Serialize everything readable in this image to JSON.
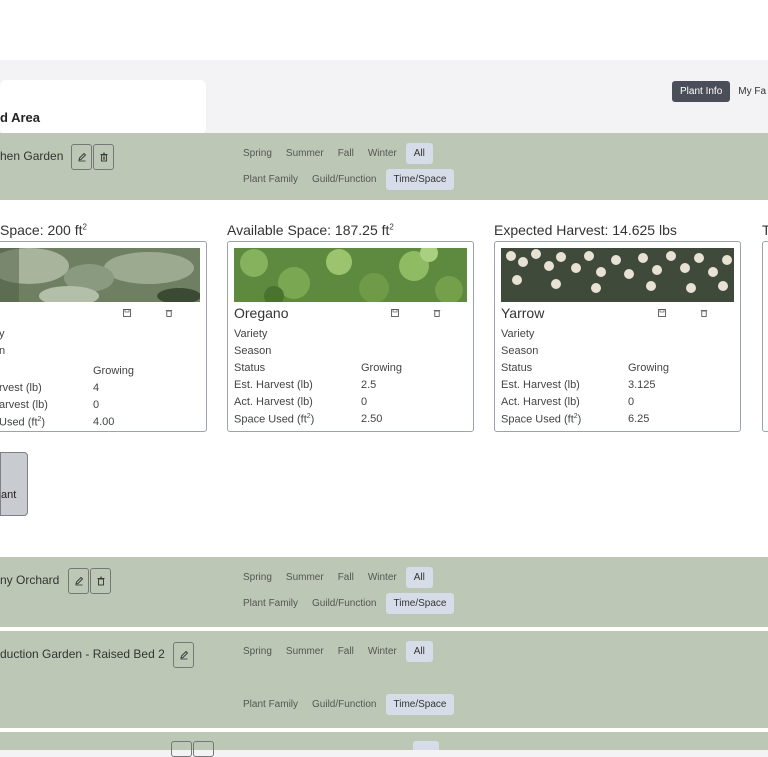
{
  "view_tabs": [
    "Plant Info",
    "My Fa"
  ],
  "area_title": "d Area",
  "seasons": [
    "Spring",
    "Summer",
    "Fall",
    "Winter",
    "All"
  ],
  "modes": [
    "Plant Family",
    "Guild/Function",
    "Time/Space"
  ],
  "beds": [
    {
      "title": "hen Garden"
    },
    {
      "title": "ny Orchard"
    },
    {
      "title": "duction Garden - Raised Bed 2"
    }
  ],
  "columns": {
    "space": {
      "label": "Space: 200 ft",
      "sup": "2"
    },
    "available": {
      "label": "Available Space: 187.25 ft",
      "sup": "2"
    },
    "harvest": {
      "label": "Expected Harvest: 14.625 lbs"
    },
    "next": {
      "label": "T"
    }
  },
  "row_labels": {
    "variety": "Variety",
    "season": "Season",
    "status": "Status",
    "est_harvest": "Est. Harvest (lb)",
    "act_harvest": "Act. Harvest (lb)",
    "space_used": "Space Used (ft",
    "space_sup": "2",
    "space_close": ")"
  },
  "cards": [
    {
      "name": "",
      "labels": [
        "y",
        "n",
        "",
        "rvest (lb)",
        "arvest (lb)",
        "Used (ft"
      ],
      "status": "Growing",
      "est": "4",
      "act": "0",
      "space": "4.00"
    },
    {
      "name": "Oregano",
      "status": "Growing",
      "est": "2.5",
      "act": "0",
      "space": "2.50"
    },
    {
      "name": "Yarrow",
      "status": "Growing",
      "est": "3.125",
      "act": "0",
      "space": "6.25"
    }
  ],
  "add_plant": {
    "label": "ant"
  },
  "icons": {
    "edit": "pencil-icon",
    "delete": "trash-icon",
    "save": "save-icon"
  }
}
